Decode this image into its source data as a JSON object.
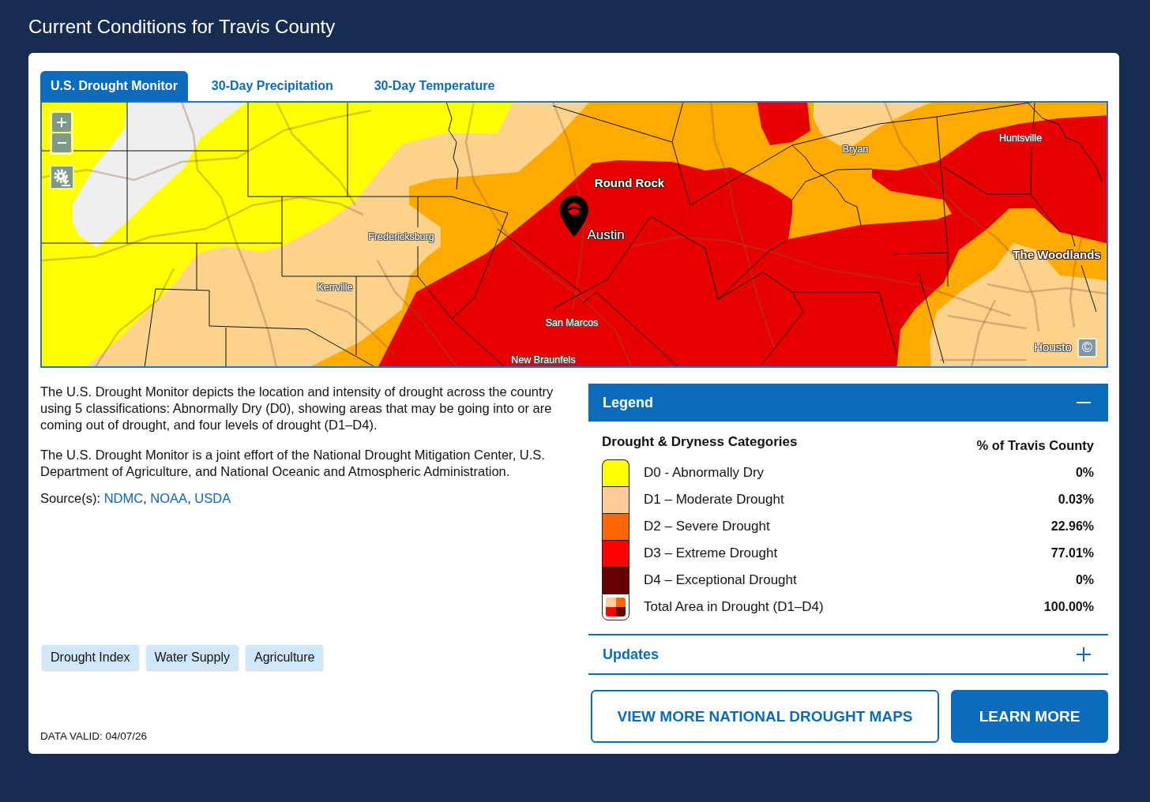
{
  "page": {
    "title": "Current Conditions for Travis County"
  },
  "tabs": [
    {
      "label": "U.S. Drought Monitor",
      "selected": true
    },
    {
      "label": "30-Day Precipitation",
      "selected": false
    },
    {
      "label": "30-Day Temperature",
      "selected": false
    }
  ],
  "map": {
    "places": [
      {
        "name": "Round Rock",
        "kind": "bold"
      },
      {
        "name": "Austin",
        "kind": "pin"
      },
      {
        "name": "Fredericksburg",
        "kind": "small"
      },
      {
        "name": "Kerrville",
        "kind": "small"
      },
      {
        "name": "San Marcos",
        "kind": "small"
      },
      {
        "name": "New Braunfels",
        "kind": "small"
      },
      {
        "name": "Bryan",
        "kind": "small"
      },
      {
        "name": "Huntsville",
        "kind": "small"
      },
      {
        "name": "The Woodlands",
        "kind": "bold"
      },
      {
        "name": "Housto",
        "kind": "regular"
      }
    ],
    "attribution_button": "©"
  },
  "description": {
    "paragraphs": [
      "The U.S. Drought Monitor depicts the location and intensity of drought across the country using 5 classifications: Abnormally Dry (D0), showing areas that may be going into or are coming out of drought, and four levels of drought (D1–D4).",
      "The U.S. Drought Monitor is a joint effort of the National Drought Mitigation Center, U.S. Department of Agriculture, and National Oceanic and Atmospheric Administration."
    ],
    "sources": {
      "label": "Source(s):",
      "separator": ", ",
      "links": [
        "NDMC",
        "NOAA",
        "USDA"
      ]
    }
  },
  "tags": [
    "Drought Index",
    "Water Supply",
    "Agriculture"
  ],
  "data_valid": "DATA VALID: 04/07/26",
  "legend": {
    "title": "Legend",
    "expanded": true,
    "heading": "Drought & Dryness Categories",
    "value_heading": "% of Travis County",
    "rows": [
      {
        "kind": "category",
        "label": "D0 - Abnormally Dry",
        "value": "0%",
        "color": "#ffff00"
      },
      {
        "kind": "category",
        "label": "D1 – Moderate Drought",
        "value": "0.03%",
        "color": "#ffcc99"
      },
      {
        "kind": "category",
        "label": "D2 – Severe Drought",
        "value": "22.96%",
        "color": "#ff6600"
      },
      {
        "kind": "category",
        "label": "D3 – Extreme Drought",
        "value": "77.01%",
        "color": "#ff0000"
      },
      {
        "kind": "category",
        "label": "D4 – Exceptional Drought",
        "value": "0%",
        "color": "#660000"
      },
      {
        "kind": "total",
        "label": "Total Area in Drought (D1–D4)",
        "value": "100.00%"
      }
    ]
  },
  "updates": {
    "title": "Updates",
    "expanded": false
  },
  "buttons": [
    {
      "label": "VIEW MORE NATIONAL DROUGHT MAPS",
      "kind": "outline"
    },
    {
      "label": "LEARN MORE",
      "kind": "filled"
    }
  ]
}
